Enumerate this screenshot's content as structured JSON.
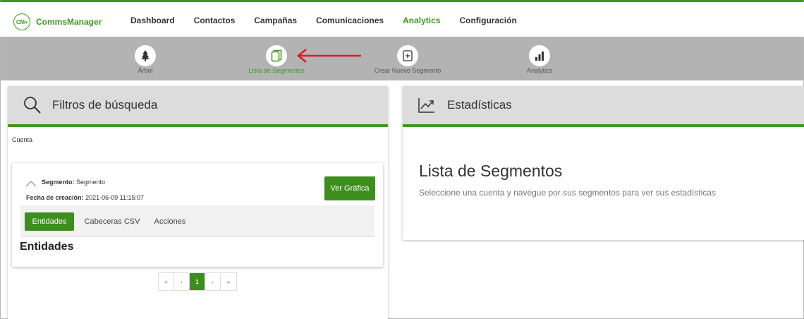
{
  "app": {
    "logo_mark": "CM+",
    "name": "CommsManager",
    "brand_color": "#3e9a1f"
  },
  "nav": {
    "items": [
      {
        "label": "Dashboard",
        "active": false
      },
      {
        "label": "Contactos",
        "active": false
      },
      {
        "label": "Campañas",
        "active": false
      },
      {
        "label": "Comunicaciones",
        "active": false
      },
      {
        "label": "Analytics",
        "active": true
      },
      {
        "label": "Configuración",
        "active": false
      }
    ]
  },
  "subnav": {
    "items": [
      {
        "label": "Árbol",
        "icon": "tree-icon",
        "active": false
      },
      {
        "label": "Lista de Segmentos",
        "icon": "segment-list-icon",
        "active": true
      },
      {
        "label": "Crear Nuevo Segmento",
        "icon": "new-segment-icon",
        "active": false
      },
      {
        "label": "Analytics",
        "icon": "bar-chart-icon",
        "active": false
      }
    ],
    "annotation_arrow_color": "#e01b24"
  },
  "filters": {
    "title": "Filtros de búsqueda",
    "cuenta_label": "Cuenta",
    "segment": {
      "segmento_label": "Segmento:",
      "segmento_value": "Segmento",
      "fecha_label": "Fecha de creación:",
      "fecha_value": "2021-06-09 11:15:07",
      "ver_grafica_label": "Ver Gráfica",
      "tabs": [
        {
          "label": "Entidades",
          "active": true
        },
        {
          "label": "Cabeceras CSV",
          "active": false
        },
        {
          "label": "Acciones",
          "active": false
        }
      ],
      "section_title": "Entidades"
    },
    "pagination": {
      "first": "«",
      "prev": "‹",
      "current": "1",
      "next": "›",
      "last": "»"
    }
  },
  "stats": {
    "title": "Estadísticas",
    "heading": "Lista de Segmentos",
    "message": "Seleccione una cuenta y navegue por sus segmentos para ver sus estadísticas"
  }
}
